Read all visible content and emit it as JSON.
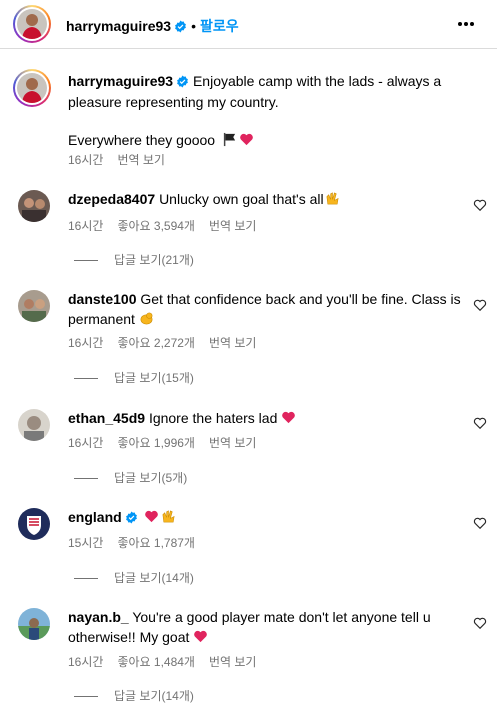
{
  "header": {
    "username": "harrymaguire93",
    "dot": "•",
    "follow_label": "팔로우"
  },
  "caption": {
    "username": "harrymaguire93",
    "text_line1": "Enjoyable camp with the lads - always a",
    "text_line2": "pleasure representing my country.",
    "text_line3": "Everywhere they goooo",
    "time": "16시간",
    "translate_label": "번역 보기"
  },
  "comments": [
    {
      "username": "dzepeda8407",
      "text": "Unlucky own goal that's all",
      "time": "16시간",
      "likes": "좋아요 3,594개",
      "translate": "번역 보기",
      "replies": "답글 보기(21개)"
    },
    {
      "username": "danste100",
      "text_line1": "Get that confidence back and you'll be fine. Class is",
      "text_line2": "permanent",
      "time": "16시간",
      "likes": "좋아요 2,272개",
      "translate": "번역 보기",
      "replies": "답글 보기(15개)"
    },
    {
      "username": "ethan_45d9",
      "text": "Ignore the haters lad",
      "time": "16시간",
      "likes": "좋아요 1,996개",
      "translate": "번역 보기",
      "replies": "답글 보기(5개)"
    },
    {
      "username": "england",
      "text": "",
      "time": "15시간",
      "likes": "좋아요 1,787개",
      "replies": "답글 보기(14개)"
    },
    {
      "username": "nayan.b_",
      "text_line1": "You're a good player mate don't let anyone tell u",
      "text_line2": "otherwise!! My goat",
      "time": "16시간",
      "likes": "좋아요 1,484개",
      "translate": "번역 보기",
      "replies": "답글 보기(14개)"
    }
  ],
  "colors": {
    "link_blue": "#0095f6",
    "verified_blue": "#0095f6",
    "secondary_text": "#737373",
    "heart_red": "#e0245e"
  },
  "icons": [
    "more-options-icon",
    "verified-badge-icon",
    "heart-outline-icon",
    "black-flag-emoji",
    "red-heart-emoji",
    "raised-hands-emoji",
    "flexed-biceps-emoji"
  ]
}
